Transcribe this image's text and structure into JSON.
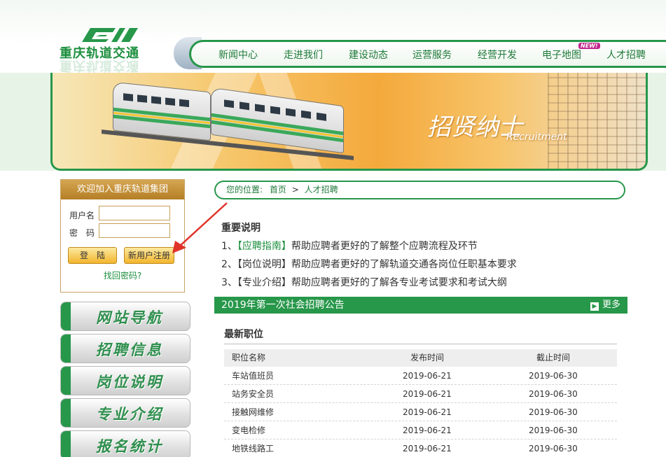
{
  "header": {
    "logo_text": "重庆轨道交通",
    "nav": [
      {
        "label": "新闻中心"
      },
      {
        "label": "走进我们"
      },
      {
        "label": "建设动态"
      },
      {
        "label": "运营服务"
      },
      {
        "label": "经营开发"
      },
      {
        "label": "电子地图"
      },
      {
        "label": "人才招聘"
      }
    ],
    "new_badge": "NEW!"
  },
  "banner": {
    "title": "招贤纳士",
    "subtitle": "Recruitment"
  },
  "login": {
    "heading": "欢迎加入重庆轨道集团",
    "username_label": "用户名",
    "password_label": "密　码",
    "username_value": "",
    "password_value": "",
    "login_button": "登　陆",
    "register_button": "新用户注册",
    "forgot_link": "找回密码?"
  },
  "side_menu": [
    {
      "label": "网站导航"
    },
    {
      "label": "招聘信息"
    },
    {
      "label": "岗位说明"
    },
    {
      "label": "专业介绍"
    },
    {
      "label": "报名统计"
    }
  ],
  "breadcrumb": {
    "label": "您的位置:",
    "home": "首页",
    "separator": ">",
    "current": "人才招聘"
  },
  "notes": {
    "title": "重要说明",
    "items": [
      {
        "num": "1、",
        "tag": "【应聘指南】",
        "text": "帮助应聘者更好的了解整个应聘流程及环节"
      },
      {
        "num": "2、",
        "tag": "【岗位说明】",
        "text": "帮助应聘者更好的了解轨道交通各岗位任职基本要求"
      },
      {
        "num": "3、",
        "tag": "【专业介绍】",
        "text": "帮助应聘者更好的了解各专业考试要求和考试大纲"
      }
    ]
  },
  "notice": {
    "title": "2019年第一次社会招聘公告",
    "more": "更多"
  },
  "jobs": {
    "title": "最新职位",
    "columns": [
      "职位名称",
      "发布时间",
      "截止时间"
    ],
    "rows": [
      [
        "车站值班员",
        "2019-06-21",
        "2019-06-30"
      ],
      [
        "站务安全员",
        "2019-06-21",
        "2019-06-30"
      ],
      [
        "接触网维修",
        "2019-06-21",
        "2019-06-30"
      ],
      [
        "变电检修",
        "2019-06-21",
        "2019-06-30"
      ],
      [
        "地铁线路工",
        "2019-06-21",
        "2019-06-30"
      ]
    ]
  },
  "colors": {
    "brand_green": "#27974a",
    "gold": "#d6a653",
    "annotation_red": "#e0342a"
  }
}
